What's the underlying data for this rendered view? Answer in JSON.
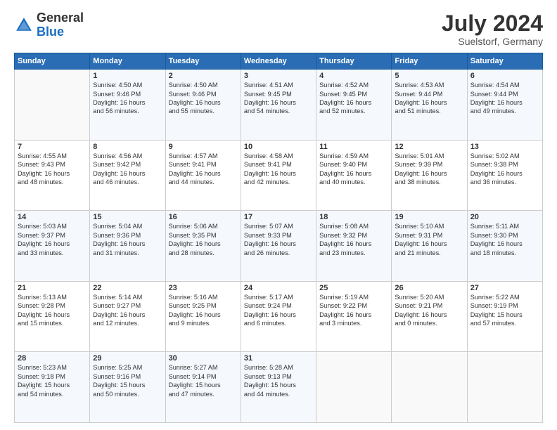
{
  "header": {
    "logo_general": "General",
    "logo_blue": "Blue",
    "month_year": "July 2024",
    "location": "Suelstorf, Germany"
  },
  "days_of_week": [
    "Sunday",
    "Monday",
    "Tuesday",
    "Wednesday",
    "Thursday",
    "Friday",
    "Saturday"
  ],
  "weeks": [
    [
      {
        "day": "",
        "info": ""
      },
      {
        "day": "1",
        "info": "Sunrise: 4:50 AM\nSunset: 9:46 PM\nDaylight: 16 hours\nand 56 minutes."
      },
      {
        "day": "2",
        "info": "Sunrise: 4:50 AM\nSunset: 9:46 PM\nDaylight: 16 hours\nand 55 minutes."
      },
      {
        "day": "3",
        "info": "Sunrise: 4:51 AM\nSunset: 9:45 PM\nDaylight: 16 hours\nand 54 minutes."
      },
      {
        "day": "4",
        "info": "Sunrise: 4:52 AM\nSunset: 9:45 PM\nDaylight: 16 hours\nand 52 minutes."
      },
      {
        "day": "5",
        "info": "Sunrise: 4:53 AM\nSunset: 9:44 PM\nDaylight: 16 hours\nand 51 minutes."
      },
      {
        "day": "6",
        "info": "Sunrise: 4:54 AM\nSunset: 9:44 PM\nDaylight: 16 hours\nand 49 minutes."
      }
    ],
    [
      {
        "day": "7",
        "info": "Sunrise: 4:55 AM\nSunset: 9:43 PM\nDaylight: 16 hours\nand 48 minutes."
      },
      {
        "day": "8",
        "info": "Sunrise: 4:56 AM\nSunset: 9:42 PM\nDaylight: 16 hours\nand 46 minutes."
      },
      {
        "day": "9",
        "info": "Sunrise: 4:57 AM\nSunset: 9:41 PM\nDaylight: 16 hours\nand 44 minutes."
      },
      {
        "day": "10",
        "info": "Sunrise: 4:58 AM\nSunset: 9:41 PM\nDaylight: 16 hours\nand 42 minutes."
      },
      {
        "day": "11",
        "info": "Sunrise: 4:59 AM\nSunset: 9:40 PM\nDaylight: 16 hours\nand 40 minutes."
      },
      {
        "day": "12",
        "info": "Sunrise: 5:01 AM\nSunset: 9:39 PM\nDaylight: 16 hours\nand 38 minutes."
      },
      {
        "day": "13",
        "info": "Sunrise: 5:02 AM\nSunset: 9:38 PM\nDaylight: 16 hours\nand 36 minutes."
      }
    ],
    [
      {
        "day": "14",
        "info": "Sunrise: 5:03 AM\nSunset: 9:37 PM\nDaylight: 16 hours\nand 33 minutes."
      },
      {
        "day": "15",
        "info": "Sunrise: 5:04 AM\nSunset: 9:36 PM\nDaylight: 16 hours\nand 31 minutes."
      },
      {
        "day": "16",
        "info": "Sunrise: 5:06 AM\nSunset: 9:35 PM\nDaylight: 16 hours\nand 28 minutes."
      },
      {
        "day": "17",
        "info": "Sunrise: 5:07 AM\nSunset: 9:33 PM\nDaylight: 16 hours\nand 26 minutes."
      },
      {
        "day": "18",
        "info": "Sunrise: 5:08 AM\nSunset: 9:32 PM\nDaylight: 16 hours\nand 23 minutes."
      },
      {
        "day": "19",
        "info": "Sunrise: 5:10 AM\nSunset: 9:31 PM\nDaylight: 16 hours\nand 21 minutes."
      },
      {
        "day": "20",
        "info": "Sunrise: 5:11 AM\nSunset: 9:30 PM\nDaylight: 16 hours\nand 18 minutes."
      }
    ],
    [
      {
        "day": "21",
        "info": "Sunrise: 5:13 AM\nSunset: 9:28 PM\nDaylight: 16 hours\nand 15 minutes."
      },
      {
        "day": "22",
        "info": "Sunrise: 5:14 AM\nSunset: 9:27 PM\nDaylight: 16 hours\nand 12 minutes."
      },
      {
        "day": "23",
        "info": "Sunrise: 5:16 AM\nSunset: 9:25 PM\nDaylight: 16 hours\nand 9 minutes."
      },
      {
        "day": "24",
        "info": "Sunrise: 5:17 AM\nSunset: 9:24 PM\nDaylight: 16 hours\nand 6 minutes."
      },
      {
        "day": "25",
        "info": "Sunrise: 5:19 AM\nSunset: 9:22 PM\nDaylight: 16 hours\nand 3 minutes."
      },
      {
        "day": "26",
        "info": "Sunrise: 5:20 AM\nSunset: 9:21 PM\nDaylight: 16 hours\nand 0 minutes."
      },
      {
        "day": "27",
        "info": "Sunrise: 5:22 AM\nSunset: 9:19 PM\nDaylight: 15 hours\nand 57 minutes."
      }
    ],
    [
      {
        "day": "28",
        "info": "Sunrise: 5:23 AM\nSunset: 9:18 PM\nDaylight: 15 hours\nand 54 minutes."
      },
      {
        "day": "29",
        "info": "Sunrise: 5:25 AM\nSunset: 9:16 PM\nDaylight: 15 hours\nand 50 minutes."
      },
      {
        "day": "30",
        "info": "Sunrise: 5:27 AM\nSunset: 9:14 PM\nDaylight: 15 hours\nand 47 minutes."
      },
      {
        "day": "31",
        "info": "Sunrise: 5:28 AM\nSunset: 9:13 PM\nDaylight: 15 hours\nand 44 minutes."
      },
      {
        "day": "",
        "info": ""
      },
      {
        "day": "",
        "info": ""
      },
      {
        "day": "",
        "info": ""
      }
    ]
  ]
}
